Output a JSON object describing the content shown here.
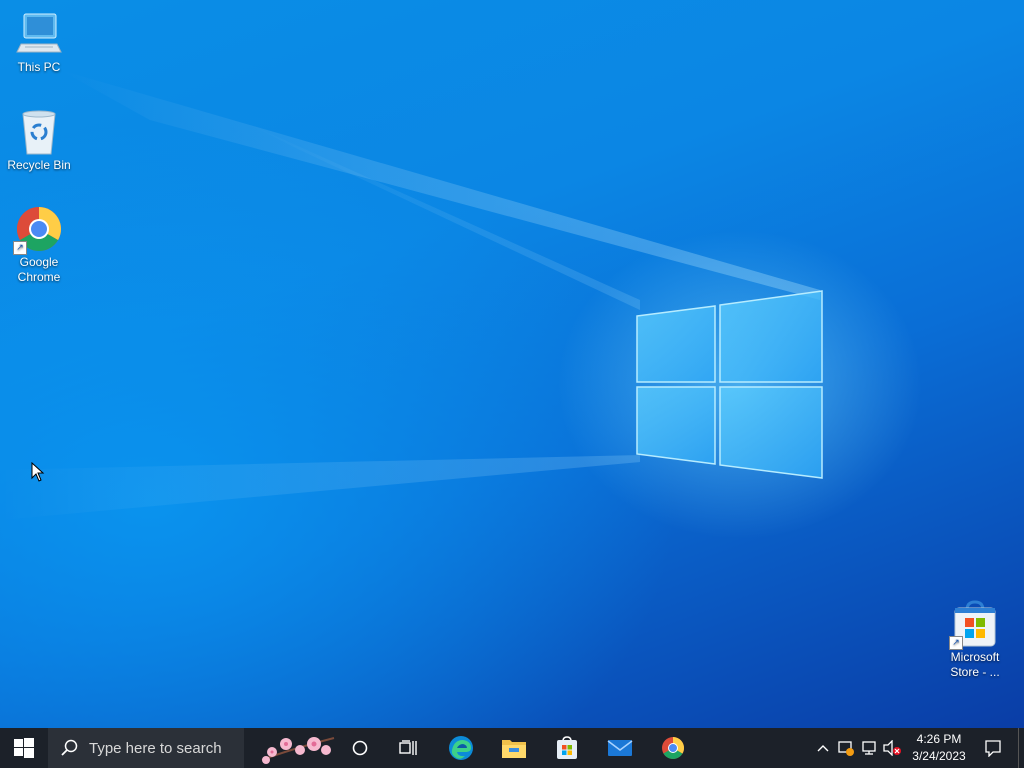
{
  "desktop": {
    "icons": [
      {
        "label": "This PC",
        "icon": "this-pc-icon"
      },
      {
        "label": "Recycle Bin",
        "icon": "recycle-bin-icon"
      },
      {
        "label_line1": "Google",
        "label_line2": "Chrome",
        "icon": "chrome-icon"
      },
      {
        "label_line1": "Microsoft",
        "label_line2": "Store - ...",
        "icon": "store-icon"
      }
    ]
  },
  "taskbar": {
    "search_placeholder": "Type here to search",
    "time": "4:26 PM",
    "date": "3/24/2023",
    "pinned": [
      "edge-icon",
      "file-explorer-icon",
      "store-icon",
      "mail-icon",
      "chrome-icon"
    ]
  },
  "colors": {
    "taskbar": "#1c2129",
    "accent": "#0a78e0"
  }
}
